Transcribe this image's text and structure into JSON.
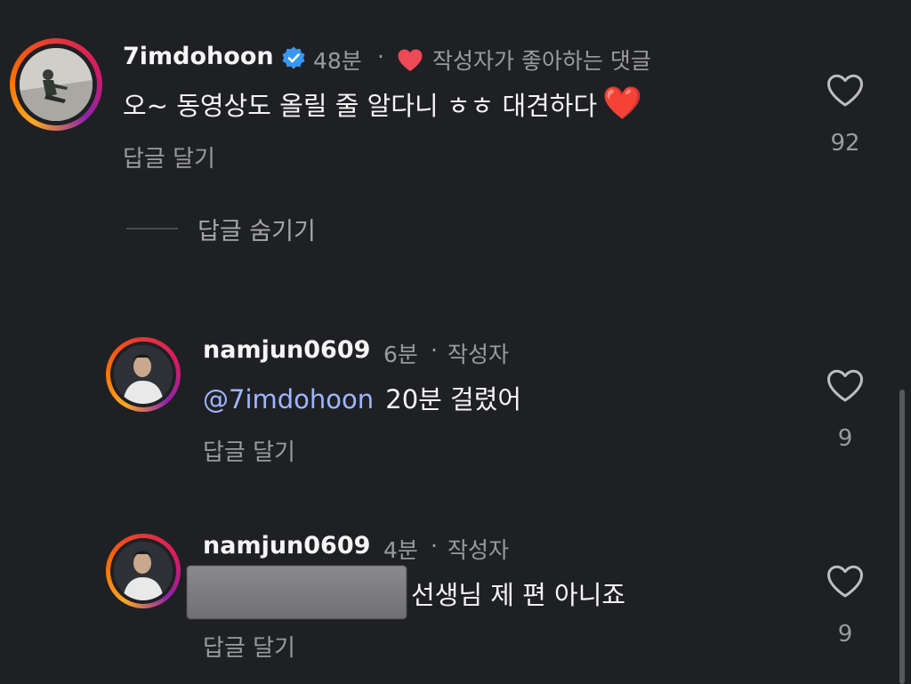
{
  "comment": {
    "username": "7imdohoon",
    "time": "48분",
    "separator": "·",
    "liked_by_author_label": "작성자가 좋아하는 댓글",
    "text": "오~ 동영상도 올릴 줄 알다니 ㅎㅎ 대견하다",
    "emoji": "❤️",
    "reply_label": "답글 달기",
    "like_count": "92",
    "hide_replies_label": "답글 숨기기"
  },
  "replies": [
    {
      "username": "namjun0609",
      "time": "6분",
      "separator": "·",
      "author_badge": "작성자",
      "mention": "@7imdohoon",
      "text": "20분 걸렸어",
      "reply_label": "답글 달기",
      "like_count": "9"
    },
    {
      "username": "namjun0609",
      "time": "4분",
      "separator": "·",
      "author_badge": "작성자",
      "text": "선생님 제 편 아니죠",
      "reply_label": "답글 달기",
      "like_count": "9"
    }
  ],
  "colors": {
    "background": "#1f2024",
    "verified": "#3897f0",
    "author_heart": "#ed4956",
    "mention": "#9fb6ff"
  },
  "icons": [
    "verified-badge-icon",
    "heart-filled-icon",
    "heart-outline-icon"
  ]
}
